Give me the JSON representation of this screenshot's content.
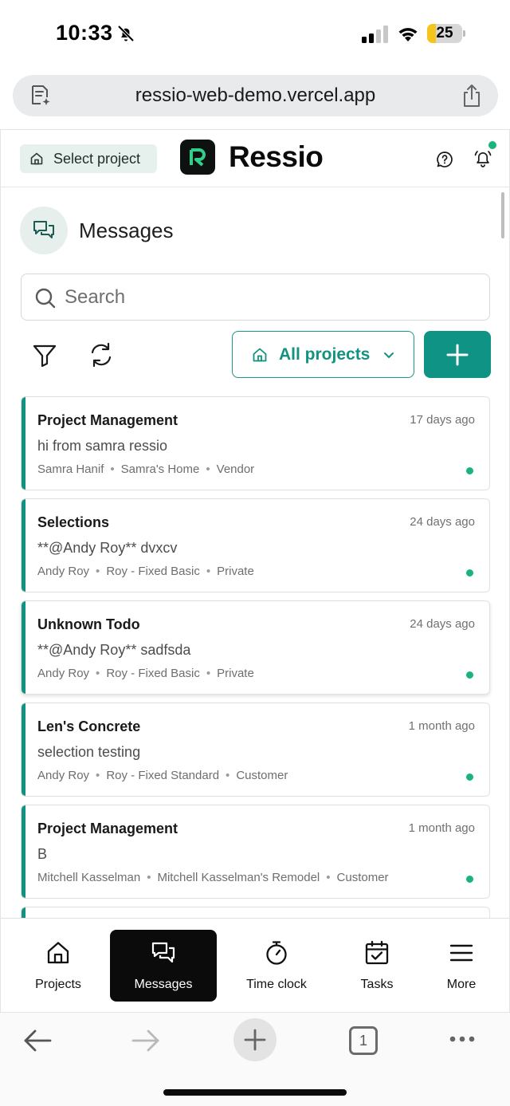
{
  "status_bar": {
    "time": "10:33",
    "battery_level": "25",
    "battery_fraction": 0.25
  },
  "browser": {
    "url": "ressio-web-demo.vercel.app",
    "open_tabs": "1"
  },
  "header": {
    "select_project_label": "Select project",
    "brand_name": "Ressio"
  },
  "page": {
    "title": "Messages",
    "search_placeholder": "Search",
    "project_filter_label": "All projects"
  },
  "messages": [
    {
      "title": "Project Management",
      "time": "17 days ago",
      "preview": "hi from samra ressio",
      "author": "Samra Hanif",
      "project": "Samra's Home",
      "audience": "Vendor"
    },
    {
      "title": "Selections",
      "time": "24 days ago",
      "preview": "**@Andy Roy** dvxcv",
      "author": "Andy Roy",
      "project": "Roy - Fixed Basic",
      "audience": "Private"
    },
    {
      "title": "Unknown Todo",
      "time": "24 days ago",
      "preview": "**@Andy Roy** sadfsda",
      "author": "Andy Roy",
      "project": "Roy - Fixed Basic",
      "audience": "Private"
    },
    {
      "title": "Len's Concrete",
      "time": "1 month ago",
      "preview": "selection testing",
      "author": "Andy Roy",
      "project": "Roy - Fixed Standard",
      "audience": "Customer"
    },
    {
      "title": "Project Management",
      "time": "1 month ago",
      "preview": "B",
      "author": "Mitchell Kasselman",
      "project": "Mitchell Kasselman's Remodel",
      "audience": "Customer"
    }
  ],
  "nav": {
    "projects": "Projects",
    "messages": "Messages",
    "time_clock": "Time clock",
    "tasks": "Tasks",
    "more": "More"
  },
  "colors": {
    "brand_teal": "#0f9384",
    "unread_dot": "#17b57b",
    "accent_bar": "#12937f",
    "battery": "#f6c51b"
  },
  "icons": {
    "status": [
      "bell-slash-icon",
      "cellular-signal-icon",
      "wifi-icon",
      "battery-icon"
    ],
    "url_bar": [
      "page-summary-icon",
      "share-icon"
    ],
    "header": [
      "home-icon",
      "ressio-logo-icon",
      "help-icon",
      "bell-icon"
    ],
    "toolbar": [
      "filter-icon",
      "refresh-icon",
      "home-icon",
      "chevron-down-icon",
      "plus-icon"
    ],
    "nav": [
      "home-icon",
      "chat-bubbles-icon",
      "stopwatch-icon",
      "calendar-check-icon",
      "menu-icon"
    ],
    "browser_bottom": [
      "back-arrow-icon",
      "forward-arrow-icon",
      "plus-icon",
      "tabs-icon",
      "ellipsis-icon"
    ]
  }
}
